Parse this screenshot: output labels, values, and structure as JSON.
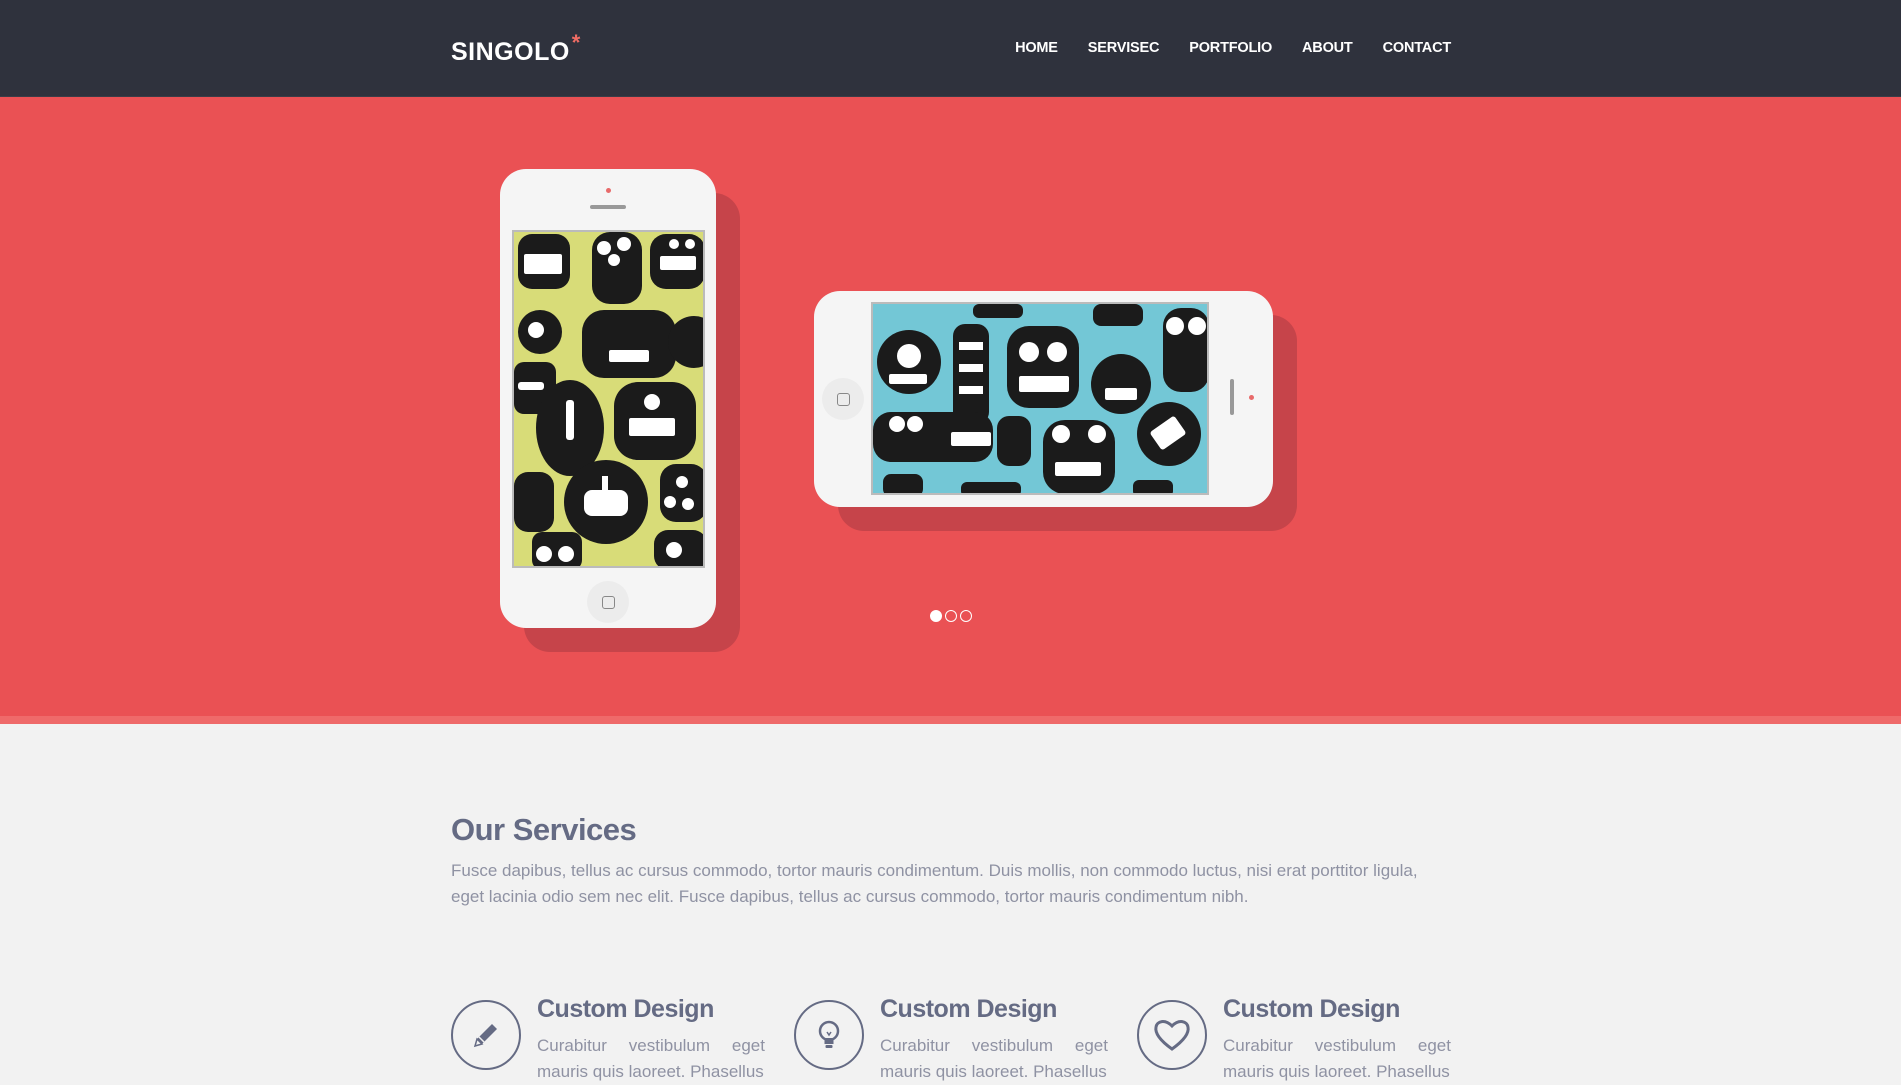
{
  "header": {
    "logo": "SINGOLO",
    "logo_mark": "*",
    "nav": [
      "HOME",
      "SERVISEC",
      "PORTFOLIO",
      "ABOUT",
      "CONTACT"
    ]
  },
  "slider": {
    "active_slide": 1,
    "slide_count": 3,
    "colors": {
      "hero": "#ea5154",
      "phone": "#f5f5f5",
      "screen_vertical": "#d8dc78",
      "screen_horizontal": "#73c7d6"
    }
  },
  "services": {
    "title": "Our Services",
    "description": "Fusce dapibus, tellus ac cursus commodo, tortor mauris condimentum. Duis mollis, non commodo luctus, nisi erat porttitor ligula, eget lacinia odio sem nec elit. Fusce dapibus, tellus ac cursus commodo, tortor mauris condimentum nibh.",
    "items": [
      {
        "icon": "pencil-icon",
        "title": "Custom Design",
        "text": "Curabitur vestibulum eget mauris quis laoreet. Phasellus"
      },
      {
        "icon": "lightbulb-icon",
        "title": "Custom Design",
        "text": "Curabitur vestibulum eget mauris quis laoreet. Phasellus"
      },
      {
        "icon": "heart-icon",
        "title": "Custom Design",
        "text": "Curabitur vestibulum eget mauris quis laoreet. Phasellus"
      }
    ]
  }
}
